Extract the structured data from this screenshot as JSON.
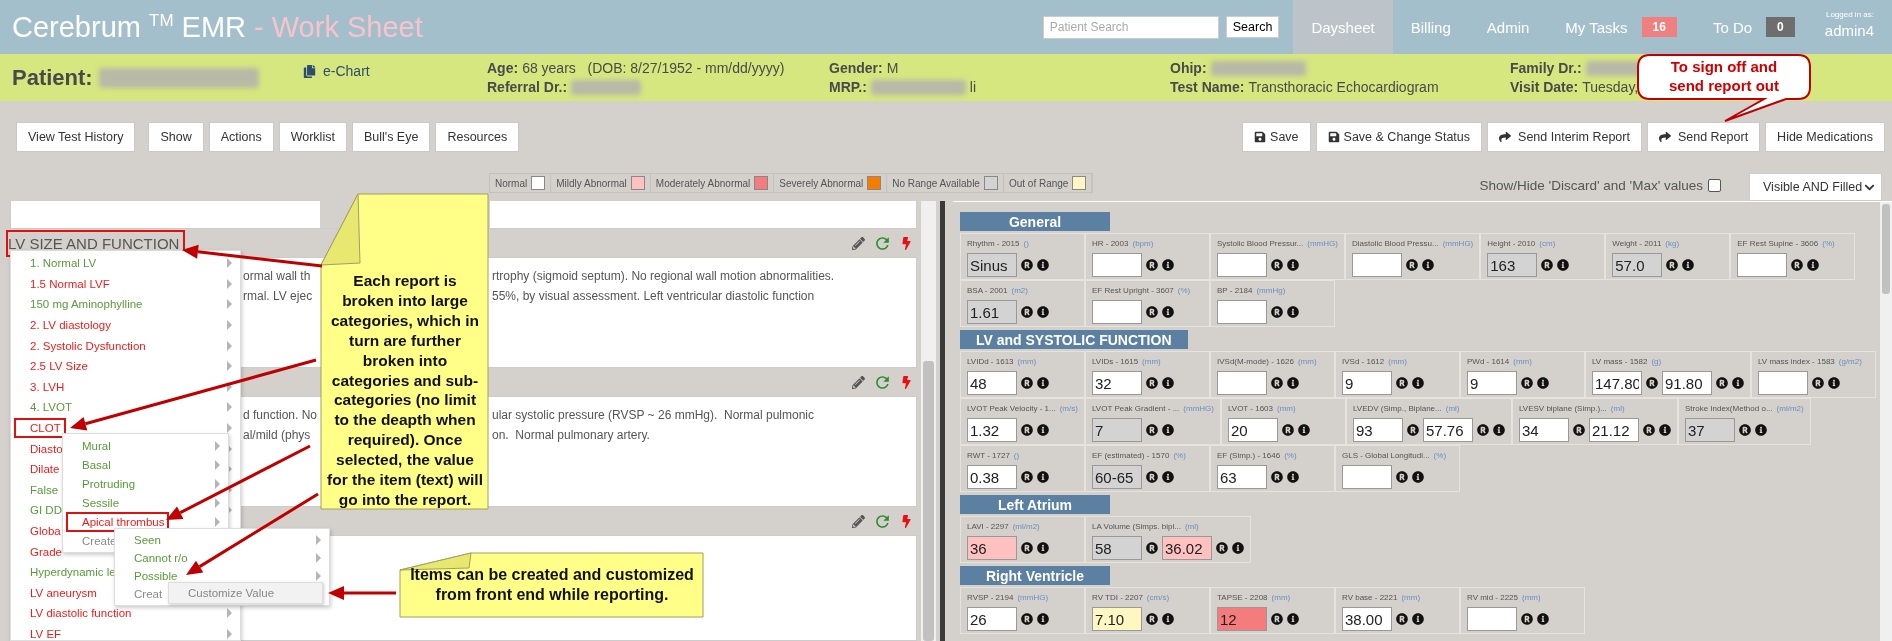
{
  "header": {
    "title": "Cerebrum $^{TM}$ EMR",
    "subtitle": "- Work Sheet",
    "search": {
      "placeholder": "Patient Search"
    },
    "search_button": "Search",
    "nav": [
      {
        "label": "Daysheet",
        "selected": true
      },
      {
        "label": "Billing",
        "selected": false
      },
      {
        "label": "Admin",
        "selected": false
      },
      {
        "label": "My Tasks",
        "selected": false,
        "badge": "16",
        "color": "#f08080"
      },
      {
        "label": "To Do",
        "selected": false,
        "badge": "0",
        "color": "#6e6e6e"
      }
    ],
    "user": {
      "caption": "Logged in as:",
      "name": "admin4"
    }
  },
  "patient": {
    "label": "Patient:",
    "name_redacted": true,
    "echart": "e-Chart",
    "columns": [
      [
        {
          "label": "Age:",
          "value": "68 years   (DOB: 8/27/1952 - mm/dd/yyyy)"
        },
        {
          "label": "Referral Dr.:",
          "redacted": true
        }
      ],
      [
        {
          "label": "Gender:",
          "value": "M"
        },
        {
          "label": "MRP.:",
          "redacted": true,
          "value": "li"
        }
      ],
      [
        {
          "label": "Ohip:",
          "redacted": true
        },
        {
          "label": "Test Name:",
          "value": "Transthoracic Echocardiogram"
        }
      ],
      [
        {
          "label": "Family Dr.:",
          "redacted": true
        },
        {
          "label": "Visit Date:",
          "value": "Tuesday,"
        }
      ]
    ]
  },
  "toolbar": {
    "left": [
      "View Test History",
      "Show",
      "Actions",
      "Worklist",
      "Bull's Eye",
      "Resources"
    ],
    "right": [
      {
        "label": "Save",
        "kind": "save"
      },
      {
        "label": "Save & Change Status",
        "kind": "save"
      },
      {
        "label": "Send Interim Report",
        "kind": "send"
      },
      {
        "label": "Send Report",
        "kind": "send"
      },
      {
        "label": "Hide Medications",
        "kind": "plain"
      }
    ]
  },
  "legend": [
    {
      "label": "Normal",
      "color": "#ffffff"
    },
    {
      "label": "Mildly Abnormal",
      "color": "#ffc0c0"
    },
    {
      "label": "Moderately Abnormal",
      "color": "#f47c7c"
    },
    {
      "label": "Severely Abnormal",
      "color": "#f57c00"
    },
    {
      "label": "No Range Available",
      "color": "#d3d3d3"
    },
    {
      "label": "Out of Range",
      "color": "#fff7c2"
    }
  ],
  "discard_toggle": {
    "label": "Show/Hide 'Discard' and 'Max' values",
    "checked": false
  },
  "view_select": {
    "value": "Visible AND Filled"
  },
  "report": {
    "sections": [
      {
        "title": "LV SIZE AND FUNCTION",
        "highlighted": true,
        "lines": [
          [
            "ormal wall th",
            "rtrophy (sigmoid septum). No regional wall motion abnormalities."
          ],
          [
            "rmal. LV ejec",
            "55%, by visual assessment. Left ventricular diastolic function"
          ]
        ]
      },
      {
        "lines": [
          [
            "d function. No",
            "ular systolic pressure (RVSP ~ 26 mmHg).  Normal pulmonic"
          ],
          [
            "al/mild (phys",
            "on.  Normal pulmonary artery."
          ]
        ]
      }
    ]
  },
  "context_menu": {
    "items": [
      {
        "label": "1. Normal LV",
        "color": "#5a9a3a",
        "highlighted": false
      },
      {
        "label": "1.5 Normal LVF",
        "color": "#ee1c1c",
        "highlighted": false
      },
      {
        "label": "150 mg Aminophylline",
        "color": "#5a9a3a",
        "highlighted": false
      },
      {
        "label": "2. LV diastology",
        "color": "#ee1c1c",
        "highlighted": false
      },
      {
        "label": "2. Systolic Dysfunction",
        "color": "#ee1c1c",
        "highlighted": false
      },
      {
        "label": "2.5 LV Size",
        "color": "#ee1c1c",
        "highlighted": false
      },
      {
        "label": "3. LVH",
        "color": "#ee1c1c",
        "highlighted": false
      },
      {
        "label": "4. LVOT",
        "color": "#5a9a3a",
        "highlighted": false
      },
      {
        "label": "CLOT",
        "color": "#ee1c1c",
        "highlighted": true,
        "children": [
          {
            "label": "Mural",
            "color": "#5a9a3a",
            "highlighted": false
          },
          {
            "label": "Basal",
            "color": "#5a9a3a",
            "highlighted": false
          },
          {
            "label": "Protruding",
            "color": "#5a9a3a",
            "highlighted": false
          },
          {
            "label": "Sessile",
            "color": "#5a9a3a",
            "highlighted": false
          },
          {
            "label": "Apical thrombus",
            "color": "#ee1c1c",
            "highlighted": true,
            "children": [
              {
                "label": "Seen",
                "color": "#5a9a3a",
                "highlighted": false
              },
              {
                "label": "Cannot r/o",
                "color": "#5a9a3a",
                "highlighted": false
              },
              {
                "label": "Possible",
                "color": "#5a9a3a",
                "highlighted": false
              },
              {
                "label": "Creat",
                "color": "#8a8a8a",
                "highlighted": false,
                "popup": "Customize Value"
              }
            ]
          },
          {
            "label": "Create",
            "color": "#8a8a8a",
            "highlighted": false
          }
        ]
      },
      {
        "label": "Diasto",
        "color": "#ee1c1c",
        "highlighted": false
      },
      {
        "label": "Dilate",
        "color": "#ee1c1c",
        "highlighted": false
      },
      {
        "label": "False",
        "color": "#5a9a3a",
        "highlighted": false
      },
      {
        "label": "GI DD",
        "color": "#5a9a3a",
        "highlighted": false
      },
      {
        "label": "Globa",
        "color": "#ee1c1c",
        "highlighted": false
      },
      {
        "label": "Grade",
        "color": "#ee1c1c",
        "highlighted": false
      },
      {
        "label": "Hyperdynamic le",
        "color": "#5a9a3a",
        "highlighted": false
      },
      {
        "label": "LV aneurysm",
        "color": "#ee1c1c",
        "highlighted": false
      },
      {
        "label": "LV diastolic function",
        "color": "#ee1c1c",
        "highlighted": false
      },
      {
        "label": "LV EF",
        "color": "#ee1c1c",
        "highlighted": false
      }
    ]
  },
  "annotations": {
    "main_note": "Each report is broken into large categories, which in turn are further broken into categories and sub-categories (no limit to the deapth when required).  Once selected, the value for the item (text) will go into the report.",
    "side_note": "Items can be created and customized from front end while reporting.",
    "bubble": "To sign off and send report out"
  },
  "measurements": {
    "sections": [
      {
        "title": "General",
        "rows": [
          [
            {
              "label": "Rhythm - 2015",
              "unit": "()",
              "inputs": [
                {
                  "value": "Sinus",
                  "color": "#d3d3d3"
                }
              ]
            },
            {
              "label": "HR - 2003",
              "unit": "(bpm)",
              "inputs": [
                {
                  "color": "#ffffff"
                }
              ]
            },
            {
              "label": "Systolic Blood Pressur...",
              "unit": "(mmHG)",
              "inputs": [
                {
                  "color": "#ffffff"
                }
              ]
            },
            {
              "label": "Diastolic Blood Pressu...",
              "unit": "(mmHG)",
              "inputs": [
                {
                  "color": "#ffffff"
                }
              ]
            },
            {
              "label": "Height - 2010",
              "unit": "(cm)",
              "inputs": [
                {
                  "value": "163",
                  "color": "#d3d3d3"
                }
              ]
            },
            {
              "label": "Weight - 2011",
              "unit": "(kg)",
              "inputs": [
                {
                  "value": "57.0",
                  "color": "#d3d3d3"
                }
              ]
            },
            {
              "label": "EF Rest Supine - 3606",
              "unit": "(%)",
              "inputs": [
                {
                  "color": "#ffffff"
                }
              ]
            }
          ],
          [
            {
              "label": "BSA - 2001",
              "unit": "(m2)",
              "inputs": [
                {
                  "value": "1.61",
                  "color": "#d3d3d3"
                }
              ]
            },
            {
              "label": "EF Rest Upright - 3607",
              "unit": "(%)",
              "inputs": [
                {
                  "color": "#ffffff"
                }
              ]
            },
            {
              "label": "BP - 2184",
              "unit": "(mmHg)",
              "inputs": [
                {
                  "color": "#ffffff"
                }
              ]
            }
          ]
        ]
      },
      {
        "title": "LV and SYSTOLIC FUNCTION",
        "rows": [
          [
            {
              "label": "LVIDd - 1613",
              "unit": "(mm)",
              "inputs": [
                {
                  "value": "48",
                  "color": "#ffffff"
                }
              ]
            },
            {
              "label": "LVIDs - 1615",
              "unit": "(mm)",
              "inputs": [
                {
                  "value": "32",
                  "color": "#ffffff"
                }
              ]
            },
            {
              "label": "IVSd(M-mode) - 1626",
              "unit": "(mm)",
              "inputs": [
                {
                  "color": "#ffffff"
                }
              ]
            },
            {
              "label": "IVSd - 1612",
              "unit": "(mm)",
              "inputs": [
                {
                  "value": "9",
                  "color": "#ffffff"
                }
              ]
            },
            {
              "label": "PWd - 1614",
              "unit": "(mm)",
              "inputs": [
                {
                  "value": "9",
                  "color": "#ffffff"
                }
              ]
            },
            {
              "label": "LV mass - 1582",
              "unit": "(g)",
              "inputs": [
                {
                  "value": "147.80",
                  "color": "#ffffff"
                },
                {
                  "value": "91.80",
                  "color": "#ffffff"
                }
              ]
            },
            {
              "label": "LV mass index - 1583",
              "unit": "(g/m2)",
              "inputs": [
                {
                  "color": "#ffffff"
                }
              ]
            }
          ],
          [
            {
              "label": "LVOT Peak Velocity - 1...",
              "unit": "(m/s)",
              "inputs": [
                {
                  "value": "1.32",
                  "color": "#ffffff"
                }
              ]
            },
            {
              "label": "LVOT Peak Gradient - ...",
              "unit": "(mmHG)",
              "inputs": [
                {
                  "value": "7",
                  "color": "#d3d3d3"
                }
              ]
            },
            {
              "label": "LVOT - 1603",
              "unit": "(mm)",
              "inputs": [
                {
                  "value": "20",
                  "color": "#ffffff"
                }
              ]
            },
            {
              "label": "LVEDV (Simp., Biplane...",
              "unit": "(ml)",
              "inputs": [
                {
                  "value": "93",
                  "color": "#ffffff"
                },
                {
                  "value": "57.76",
                  "color": "#ffffff"
                }
              ]
            },
            {
              "label": "LVESV biplane (Simp.)...",
              "unit": "(ml)",
              "inputs": [
                {
                  "value": "34",
                  "color": "#ffffff"
                },
                {
                  "value": "21.12",
                  "color": "#ffffff"
                }
              ]
            },
            {
              "label": "Stroke Index(Method o...",
              "unit": "(ml/m2)",
              "inputs": [
                {
                  "value": "37",
                  "color": "#d3d3d3"
                }
              ]
            }
          ],
          [
            {
              "label": "RWT - 1727",
              "unit": "()",
              "inputs": [
                {
                  "value": "0.38",
                  "color": "#ffffff"
                }
              ]
            },
            {
              "label": "EF (estimated) - 1570",
              "unit": "(%)",
              "inputs": [
                {
                  "value": "60-65",
                  "color": "#d3d3d3"
                }
              ]
            },
            {
              "label": "EF (Simp.) - 1646",
              "unit": "(%)",
              "inputs": [
                {
                  "value": "63",
                  "color": "#ffffff"
                }
              ]
            },
            {
              "label": "GLS - Global Longitudi...",
              "unit": "(%)",
              "inputs": [
                {
                  "color": "#ffffff"
                }
              ]
            }
          ]
        ]
      },
      {
        "title": "Left Atrium",
        "rows": [
          [
            {
              "label": "LAVI - 2297",
              "unit": "(ml/m2)",
              "inputs": [
                {
                  "value": "36",
                  "color": "#ffc0c0"
                }
              ]
            },
            {
              "label": "LA Volume (Simps. bipl...",
              "unit": "(ml)",
              "inputs": [
                {
                  "value": "58",
                  "color": "#d3d3d3"
                },
                {
                  "value": "36.02",
                  "color": "#ffc0c0"
                }
              ]
            }
          ]
        ]
      },
      {
        "title": "Right Ventricle",
        "rows": [
          [
            {
              "label": "RVSP - 2194",
              "unit": "(mmHG)",
              "inputs": [
                {
                  "value": "26",
                  "color": "#ffffff"
                }
              ]
            },
            {
              "label": "RV TDI - 2207",
              "unit": "(cm/s)",
              "inputs": [
                {
                  "value": "7.10",
                  "color": "#fff7c2"
                }
              ]
            },
            {
              "label": "TAPSE - 2208",
              "unit": "(mm)",
              "inputs": [
                {
                  "value": "12",
                  "color": "#f47c7c"
                }
              ]
            },
            {
              "label": "RV base - 2221",
              "unit": "(mm)",
              "inputs": [
                {
                  "value": "38.00",
                  "color": "#ffffff"
                }
              ]
            },
            {
              "label": "RV mid - 2225",
              "unit": "(mm)",
              "inputs": [
                {
                  "color": "#ffffff"
                }
              ]
            }
          ]
        ]
      }
    ]
  }
}
